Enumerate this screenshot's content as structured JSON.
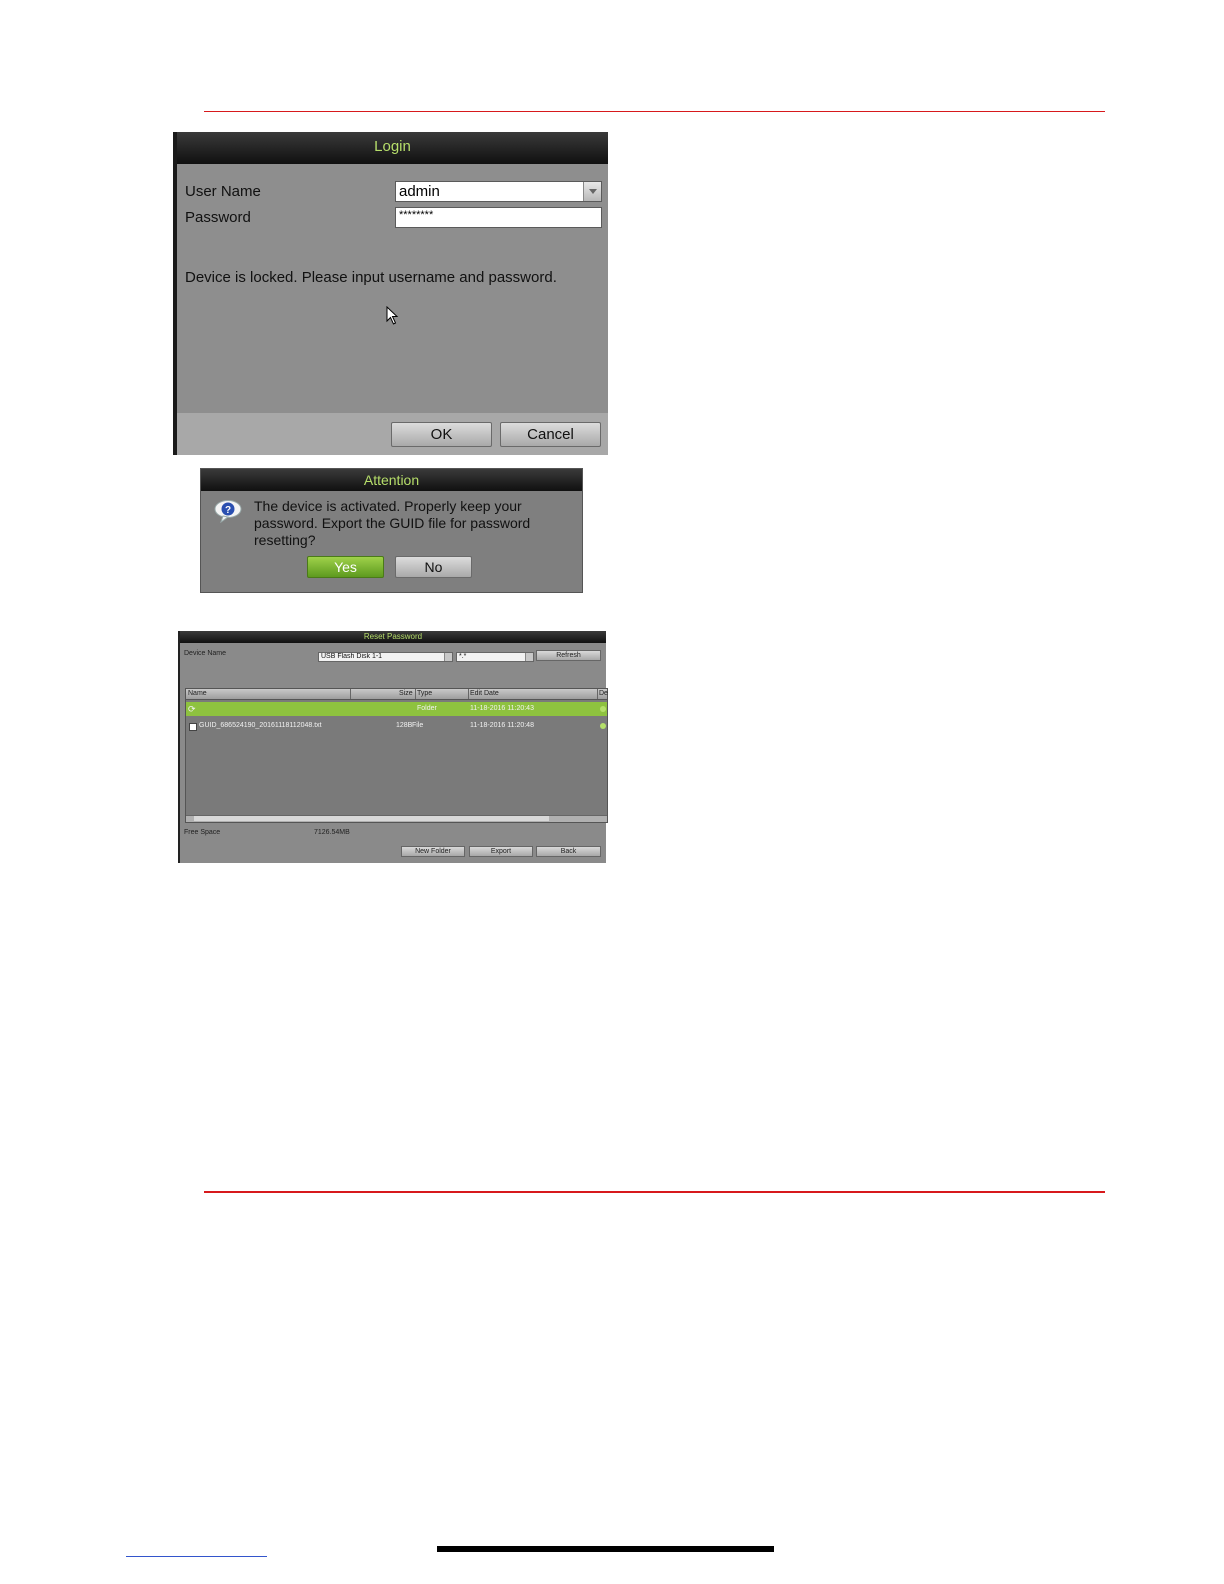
{
  "login": {
    "title": "Login",
    "username_label": "User Name",
    "username_value": "admin",
    "password_label": "Password",
    "password_value": "********",
    "message": "Device is locked. Please input username and password.",
    "ok_label": "OK",
    "cancel_label": "Cancel"
  },
  "attention": {
    "title": "Attention",
    "message": "The device is activated. Properly keep your password. Export the GUID file for password resetting?",
    "yes_label": "Yes",
    "no_label": "No",
    "icon": "question-icon"
  },
  "reset": {
    "title": "Reset Password",
    "device_name_label": "Device Name",
    "device_value": "USB Flash Disk 1-1",
    "filter_value": "*.*",
    "refresh_label": "Refresh",
    "columns": [
      "Name",
      "Size",
      "Type",
      "Edit Date",
      "De"
    ],
    "rows": [
      {
        "name": "",
        "size": "",
        "type": "Folder",
        "date": "11-18-2016 11:20:43"
      },
      {
        "name": "GUID_686524190_20161118112048.txt",
        "size": "128B",
        "type": "File",
        "date": "11-18-2016 11:20:48"
      }
    ],
    "free_space_label": "Free Space",
    "free_space_value": "7126.54MB",
    "new_folder_label": "New Folder",
    "export_label": "Export",
    "back_label": "Back"
  },
  "colors": {
    "title_text": "#b6de6a",
    "accent_green": "#8ec23f",
    "rule_red": "#d7191c"
  }
}
